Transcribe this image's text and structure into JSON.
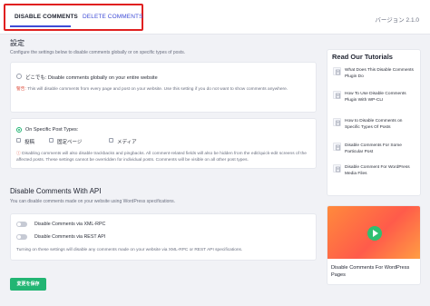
{
  "tabs": {
    "disable": "DISABLE COMMENTS",
    "delete": "DELETE COMMENTS"
  },
  "version": "バージョン 2.1.0",
  "settings": {
    "title": "設定",
    "desc": "Configure the settings below to disable comments globally or on specific types of posts.",
    "everywhere_label": "どこでも: Disable comments globally on your entire website",
    "everywhere_note_warn": "警告:",
    "everywhere_note": " This will disable comments from every page and post on your website. Use this setting if you do not want to show comments anywhere.",
    "specific_label": "On Specific Post Types:",
    "post_types": [
      "投稿",
      "固定ページ",
      "メディア"
    ],
    "specific_note_warn": "ⓘ",
    "specific_note": " Disabling comments will also disable trackbacks and pingbacks. All comment-related fields will also be hidden from the edit/quick-edit screens of the affected posts. These settings cannot be overridden for individual posts. Comments will be visible on all other post types."
  },
  "api": {
    "title": "Disable Comments With API",
    "desc": "You can disable comments made on your website using WordPress specifications.",
    "xmlrpc": "Disable Comments via XML-RPC",
    "rest": "Disable Comments via REST API",
    "note": "Turning on these settings will disable any comments made on your website via XML-RPC or REST API specifications."
  },
  "save_label": "変更を保存",
  "sidebar": {
    "title": "Read Our Tutorials",
    "items": [
      "What Does This Disable Comments Plugin Do",
      "How To Use Disable Comments Plugin With WP-CLI",
      "How to Disable Comments on Specific Types Of Posts",
      "Disable Comments For Some Particular Post",
      "Disable Comment For WordPress Media Files"
    ],
    "video_title": "Disable Comments For WordPress Pages"
  },
  "colors": {
    "accent": "#3f4cd6",
    "primary_button": "#22b573",
    "highlight_outline": "#e02020",
    "warning": "#e05b4b"
  }
}
